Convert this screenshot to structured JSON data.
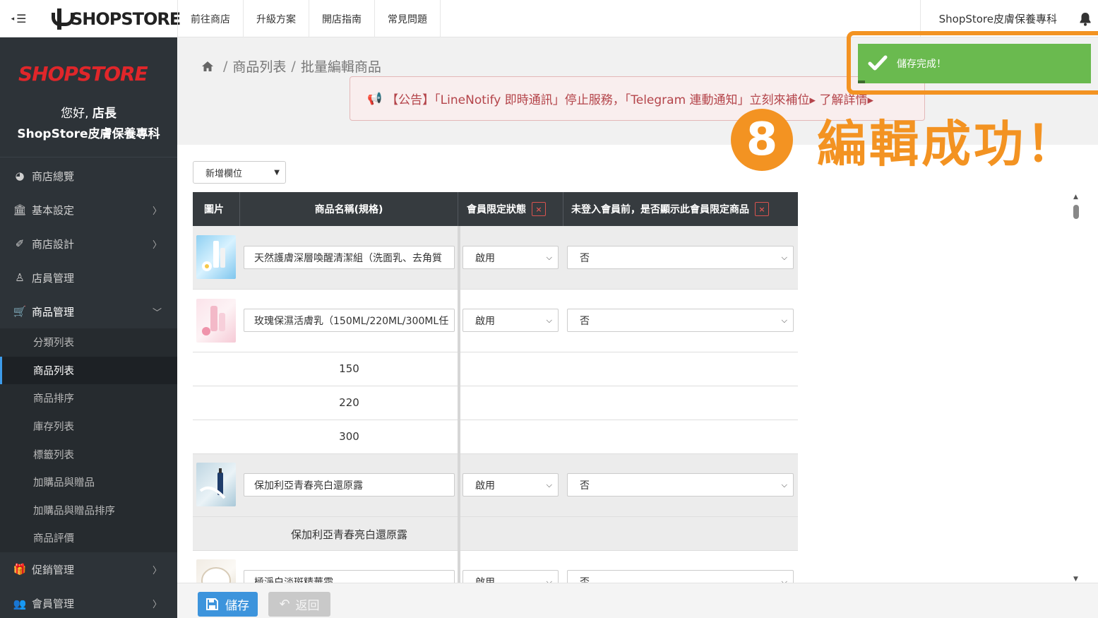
{
  "topbar": {
    "brand": "SHOPSTORE",
    "nav": [
      "前往商店",
      "升級方案",
      "開店指南",
      "常見問題"
    ],
    "store_name": "ShopStore皮膚保養專科"
  },
  "sidebar": {
    "logo": "SHOPSTORE",
    "greeting_prefix": "您好,",
    "greeting_name": "店長",
    "store_name": "ShopStore皮膚保養專科",
    "menu": [
      {
        "label": "商店總覽",
        "icon": "dashboard-icon"
      },
      {
        "label": "基本設定",
        "icon": "bank-icon"
      },
      {
        "label": "商店設計",
        "icon": "magic-wand-icon"
      },
      {
        "label": "店員管理",
        "icon": "user-staff-icon"
      },
      {
        "label": "商品管理",
        "icon": "cart-icon"
      }
    ],
    "submenu": [
      "分類列表",
      "商品列表",
      "商品排序",
      "庫存列表",
      "標籤列表",
      "加購品與贈品",
      "加購品與贈品排序",
      "商品評價"
    ],
    "menu_after": [
      {
        "label": "促銷管理",
        "icon": "gift-icon"
      },
      {
        "label": "會員管理",
        "icon": "users-icon"
      }
    ]
  },
  "breadcrumb": {
    "items": [
      "商品列表",
      "批量編輯商品"
    ],
    "separator": "/"
  },
  "notice": {
    "text": "【公告】「LineNotify 即時通訊」停止服務，「Telegram 連動通知」立刻來補位▸ 了解詳情▸"
  },
  "add_column": {
    "label": "新增欄位"
  },
  "table": {
    "headers": {
      "image": "圖片",
      "name": "商品名稱(規格)",
      "member_limit": "會員限定狀態",
      "show_before_login": "未登入會員前，是否顯示此會員限定商品",
      "remove": "×"
    },
    "rows": [
      {
        "name": "天然護膚深層喚醒清潔組（洗面乳、去角質",
        "member_limit": "啟用",
        "show": "否"
      },
      {
        "name": "玫瑰保濕活膚乳（150ML/220ML/300ML任",
        "member_limit": "啟用",
        "show": "否",
        "specs": [
          "150",
          "220",
          "300"
        ]
      },
      {
        "name": "保加利亞青春亮白還原露",
        "member_limit": "啟用",
        "show": "否",
        "specs": [
          "保加利亞青春亮白還原露"
        ]
      },
      {
        "name": "極淨白淡斑精華霜",
        "member_limit": "啟用",
        "show": "否"
      }
    ]
  },
  "buttons": {
    "save": "儲存",
    "back": "返回"
  },
  "toast": {
    "message": "儲存完成！"
  },
  "annotation": {
    "step": "8",
    "text": "編輯成功！"
  },
  "colors": {
    "accent": "#f39322",
    "success": "#6aba4f",
    "primary": "#3d94dc",
    "sidebar": "#2d3338"
  }
}
